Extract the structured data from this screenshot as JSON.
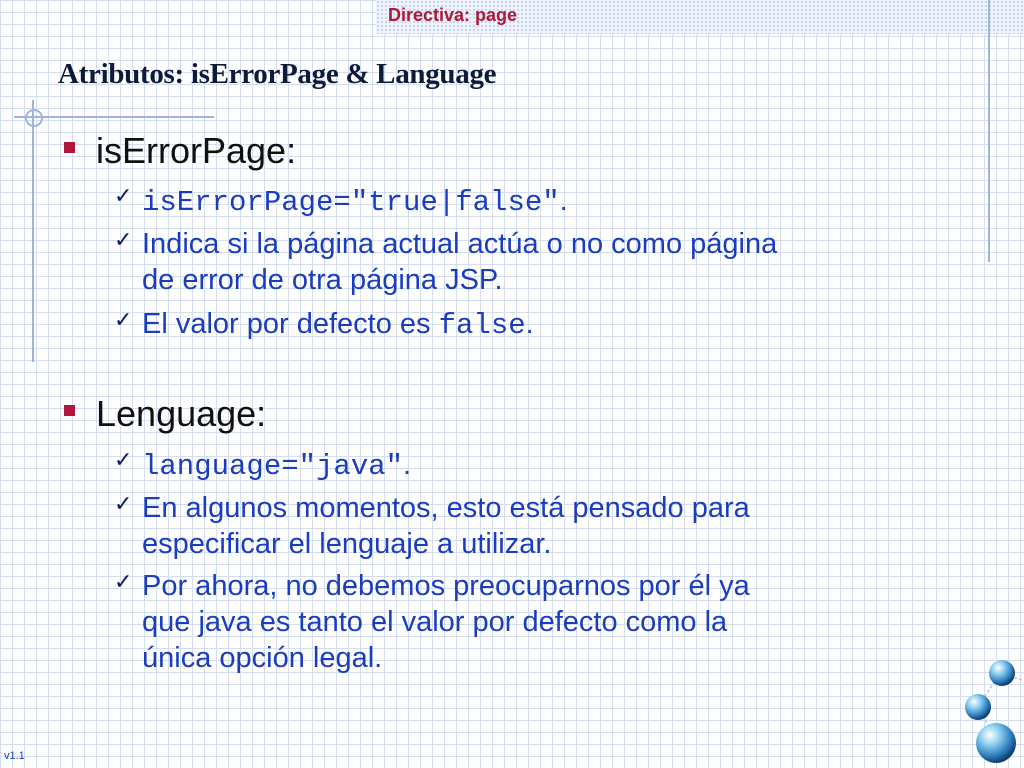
{
  "header": {
    "section_title": "Directiva: page"
  },
  "slide": {
    "title": "Atributos: isErrorPage & Language",
    "bullets": [
      {
        "label": "isErrorPage:",
        "subitems": [
          {
            "code": "isErrorPage=\"true|false\"",
            "suffix": "."
          },
          {
            "text": "Indica si la página actual actúa o no como página",
            "text_line2": "de error de otra página JSP."
          },
          {
            "text": "El valor por defecto es ",
            "code": "false",
            "suffix": "."
          }
        ]
      },
      {
        "label": "Lenguage:",
        "subitems": [
          {
            "code": "language=\"java\"",
            "suffix": "."
          },
          {
            "text": "En algunos momentos, esto está pensado para",
            "text_line2": "especificar el lenguaje a utilizar."
          },
          {
            "text": "Por ahora, no debemos preocuparnos por él ya",
            "text_line2": "que java es tanto el valor por defecto como la",
            "text_line3": "única opción legal."
          }
        ]
      }
    ]
  },
  "footer": {
    "version": "v1.1"
  },
  "icons": {
    "check": "checkmark-icon",
    "bullet": "square-bullet-icon",
    "decoration": "blue-orbs-icon"
  },
  "colors": {
    "accent": "#b0173a",
    "body_text": "#1a3cbf",
    "heading": "#0e1a3a",
    "grid": "#d5deef"
  }
}
